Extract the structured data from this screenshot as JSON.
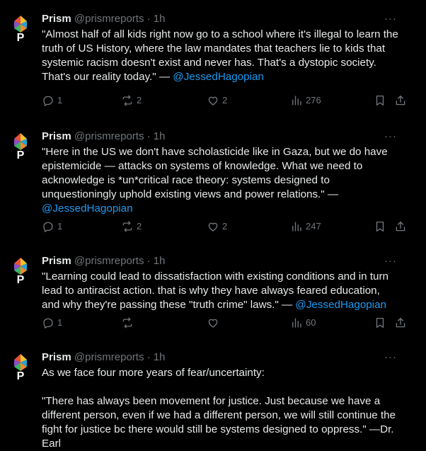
{
  "colors": {
    "background": "#000000",
    "text": "#e7e9ea",
    "muted": "#71767b",
    "link": "#1d9bf0"
  },
  "icons": {
    "avatar": "prism-logo-icon",
    "more": "more-dots-icon",
    "reply": "reply-icon",
    "repost": "repost-icon",
    "like": "heart-icon",
    "views": "views-chart-icon",
    "bookmark": "bookmark-icon",
    "share": "share-icon"
  },
  "posts": [
    {
      "name": "Prism",
      "handle": "@prismreports",
      "separator": "·",
      "time": "1h",
      "more": "···",
      "text_lines": [
        "\"Almost half of all kids right now go to a school where it's illegal to learn the",
        "truth of US History, where the law mandates that teachers lie to kids that",
        "systemic racism doesn't exist and never has. That's a dystopic society.",
        "That's our reality today.\" — "
      ],
      "mention": "@JessedHagopian",
      "replies": "1",
      "reposts": "2",
      "likes": "2",
      "views": "276"
    },
    {
      "name": "Prism",
      "handle": "@prismreports",
      "separator": "·",
      "time": "1h",
      "more": "···",
      "text_lines": [
        "\"Here in the US we don't have scholasticide like in Gaza, but we do have",
        "epistemicide — attacks on systems of knowledge. What we need to",
        "acknowledge is *un*critical race theory: systems designed to",
        "unquestioningly uphold existing views and power relations.\" —"
      ],
      "mention": "@JessedHagopian",
      "replies": "1",
      "reposts": "2",
      "likes": "2",
      "views": "247"
    },
    {
      "name": "Prism",
      "handle": "@prismreports",
      "separator": "·",
      "time": "1h",
      "more": "···",
      "text_lines": [
        "\"Learning could lead to dissatisfaction with existing conditions and in turn",
        "lead to antiracist action. that is why they have always feared education,",
        "and why they're passing these \"truth crime\" laws.\" — "
      ],
      "mention": "@JessedHagopian",
      "replies": "1",
      "reposts": "",
      "likes": "",
      "views": "60"
    },
    {
      "name": "Prism",
      "handle": "@prismreports",
      "separator": "·",
      "time": "1h",
      "more": "···",
      "intro": "As we face four more years of fear/uncertainty:",
      "text_lines": [
        "\"There has always been movement for justice. Just because we have a",
        "different person, even if we had a different person, we will still continue the",
        "fight for justice bc there would still be systems designed to oppress.\"  —Dr.",
        "Earl"
      ]
    }
  ]
}
